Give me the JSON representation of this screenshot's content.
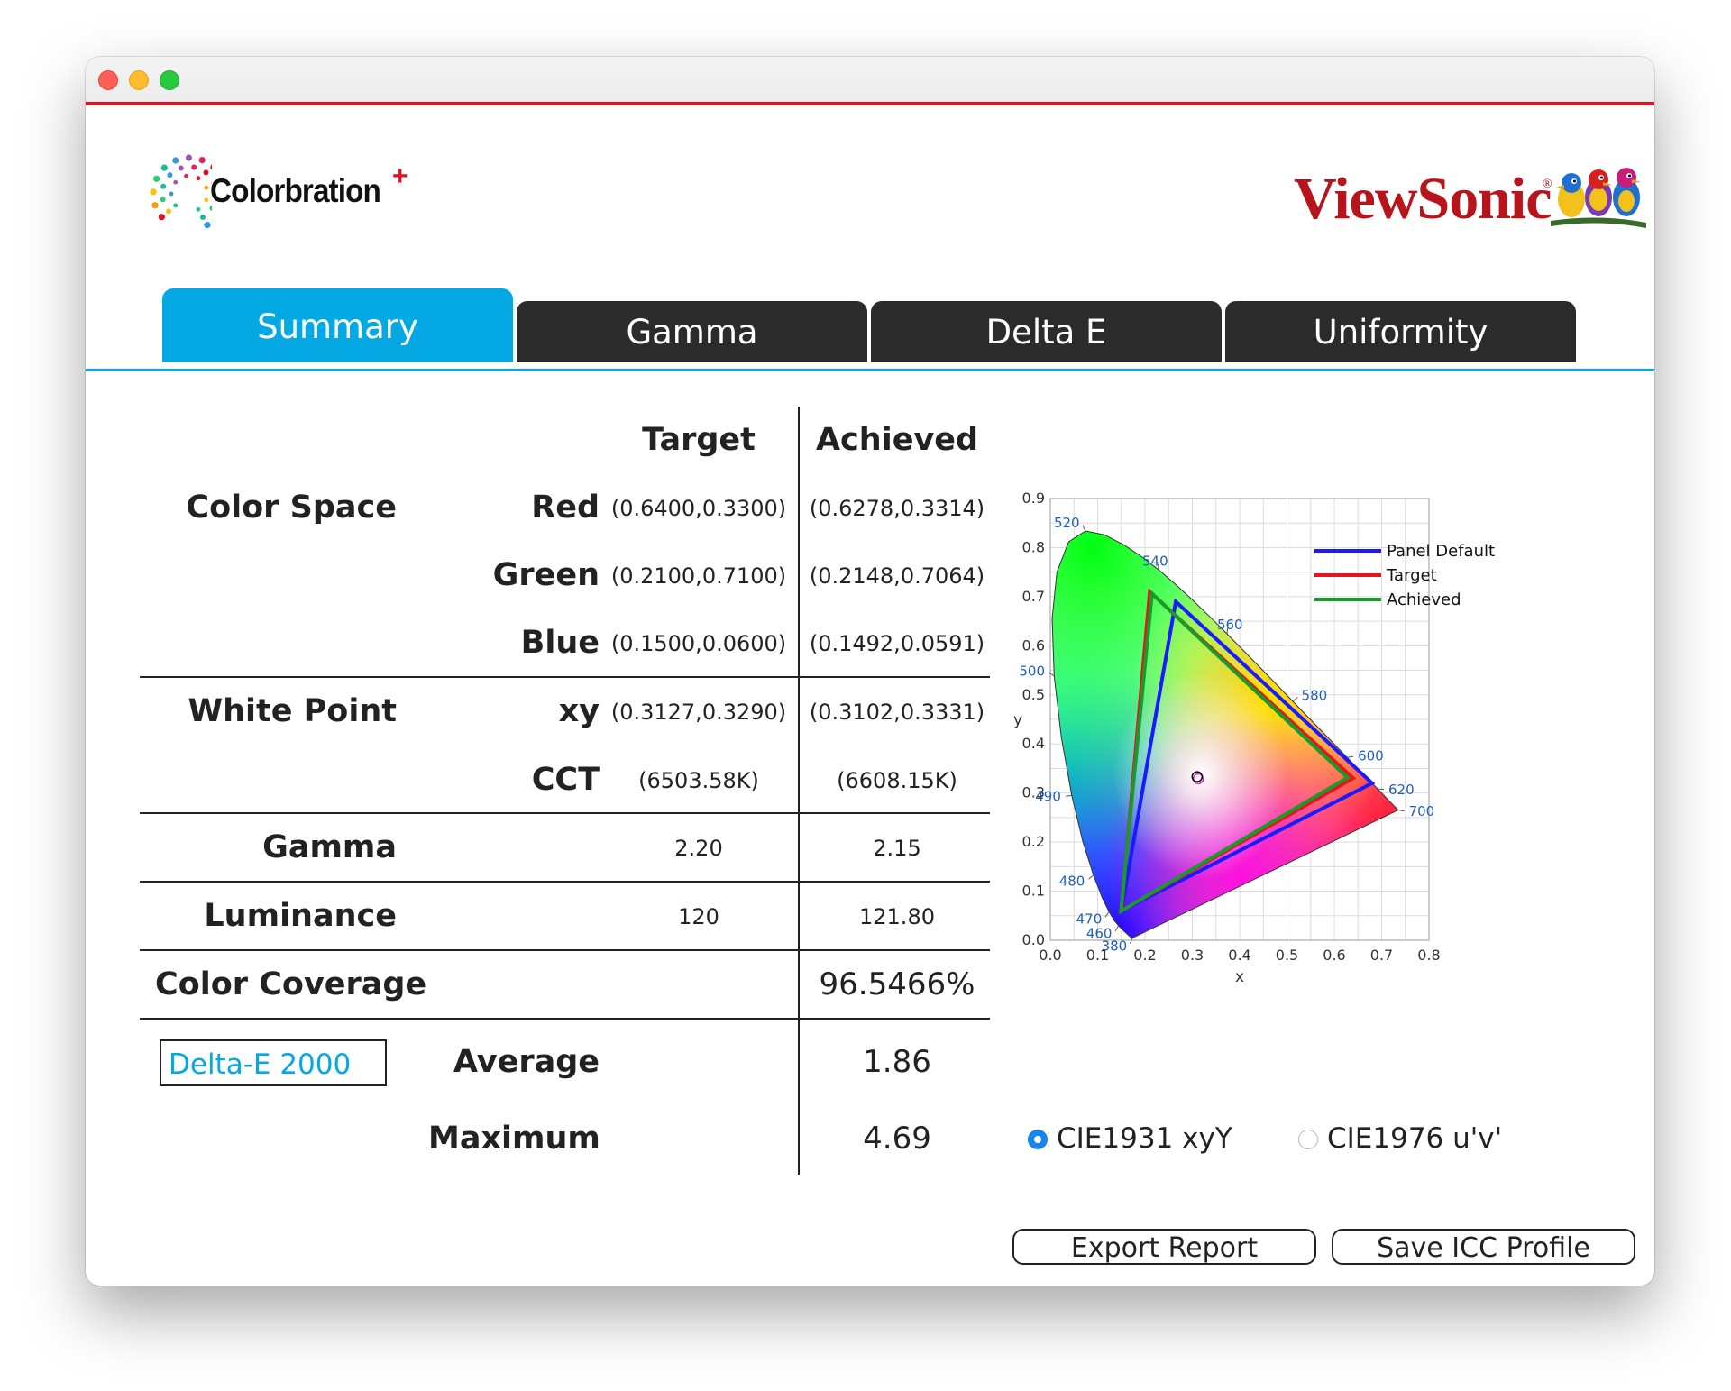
{
  "brand": {
    "left_logo": "Colorbration",
    "left_logo_mark": "+",
    "right_logo": "ViewSonic",
    "right_logo_mark": "®"
  },
  "tabs": [
    {
      "label": "Summary"
    },
    {
      "label": "Gamma"
    },
    {
      "label": "Delta E"
    },
    {
      "label": "Uniformity"
    }
  ],
  "table": {
    "header_target": "Target",
    "header_achieved": "Achieved",
    "color_space_label": "Color Space",
    "red_label": "Red",
    "green_label": "Green",
    "blue_label": "Blue",
    "red_target": "(0.6400,0.3300)",
    "red_achieved": "(0.6278,0.3314)",
    "green_target": "(0.2100,0.7100)",
    "green_achieved": "(0.2148,0.7064)",
    "blue_target": "(0.1500,0.0600)",
    "blue_achieved": "(0.1492,0.0591)",
    "white_point_label": "White Point",
    "xy_label": "xy",
    "cct_label": "CCT",
    "wp_xy_target": "(0.3127,0.3290)",
    "wp_xy_achieved": "(0.3102,0.3331)",
    "cct_target": "(6503.58K)",
    "cct_achieved": "(6608.15K)",
    "gamma_label": "Gamma",
    "gamma_target": "2.20",
    "gamma_achieved": "2.15",
    "luminance_label": "Luminance",
    "luminance_target": "120",
    "luminance_achieved": "121.80",
    "coverage_label": "Color Coverage",
    "coverage_achieved": "96.5466%",
    "delta_select": "Delta-E 2000",
    "average_label": "Average",
    "average_value": "1.86",
    "maximum_label": "Maximum",
    "maximum_value": "4.69"
  },
  "chart_data": {
    "type": "scatter",
    "xlabel": "x",
    "ylabel": "y",
    "xlim": [
      0,
      0.8
    ],
    "ylim": [
      0,
      0.9
    ],
    "xticks": [
      "0.0",
      "0.1",
      "0.2",
      "0.3",
      "0.4",
      "0.5",
      "0.6",
      "0.7",
      "0.8"
    ],
    "yticks": [
      "0.0",
      "0.1",
      "0.2",
      "0.3",
      "0.4",
      "0.5",
      "0.6",
      "0.7",
      "0.8",
      "0.9"
    ],
    "grid": true,
    "legend_position": "top-right",
    "locus": [
      [
        0.1741,
        0.005
      ],
      [
        0.1738,
        0.0049
      ],
      [
        0.1736,
        0.0049
      ],
      [
        0.1733,
        0.0048
      ],
      [
        0.173,
        0.0048
      ],
      [
        0.1726,
        0.0048
      ],
      [
        0.1721,
        0.0048
      ],
      [
        0.1714,
        0.0051
      ],
      [
        0.1703,
        0.0058
      ],
      [
        0.1689,
        0.0069
      ],
      [
        0.1669,
        0.0086
      ],
      [
        0.1644,
        0.0109
      ],
      [
        0.1611,
        0.0138
      ],
      [
        0.1566,
        0.0177
      ],
      [
        0.151,
        0.0227
      ],
      [
        0.144,
        0.0297
      ],
      [
        0.1355,
        0.0399
      ],
      [
        0.1241,
        0.0578
      ],
      [
        0.1096,
        0.0868
      ],
      [
        0.0913,
        0.1327
      ],
      [
        0.0687,
        0.2007
      ],
      [
        0.0454,
        0.295
      ],
      [
        0.0235,
        0.4127
      ],
      [
        0.0082,
        0.5384
      ],
      [
        0.0039,
        0.6548
      ],
      [
        0.0139,
        0.7502
      ],
      [
        0.0389,
        0.812
      ],
      [
        0.0743,
        0.8338
      ],
      [
        0.1142,
        0.8262
      ],
      [
        0.1547,
        0.8059
      ],
      [
        0.1929,
        0.7816
      ],
      [
        0.2296,
        0.7543
      ],
      [
        0.2658,
        0.7243
      ],
      [
        0.3016,
        0.6923
      ],
      [
        0.3373,
        0.6589
      ],
      [
        0.3731,
        0.6245
      ],
      [
        0.4087,
        0.5896
      ],
      [
        0.4441,
        0.5547
      ],
      [
        0.4788,
        0.5202
      ],
      [
        0.5125,
        0.4866
      ],
      [
        0.5448,
        0.4544
      ],
      [
        0.5752,
        0.4242
      ],
      [
        0.6029,
        0.3965
      ],
      [
        0.627,
        0.3725
      ],
      [
        0.6482,
        0.3514
      ],
      [
        0.6658,
        0.334
      ],
      [
        0.6801,
        0.3197
      ],
      [
        0.6915,
        0.3083
      ],
      [
        0.7006,
        0.2993
      ],
      [
        0.7079,
        0.292
      ],
      [
        0.714,
        0.2859
      ],
      [
        0.719,
        0.2809
      ],
      [
        0.723,
        0.277
      ],
      [
        0.726,
        0.274
      ],
      [
        0.7283,
        0.2717
      ],
      [
        0.73,
        0.27
      ],
      [
        0.7311,
        0.2689
      ],
      [
        0.732,
        0.268
      ],
      [
        0.7327,
        0.2673
      ],
      [
        0.7334,
        0.2666
      ],
      [
        0.734,
        0.266
      ],
      [
        0.7344,
        0.2656
      ],
      [
        0.7346,
        0.2654
      ],
      [
        0.7347,
        0.2653
      ]
    ],
    "wavelength_labels": [
      {
        "label": "520",
        "x": 0.0743,
        "y": 0.8338
      },
      {
        "label": "540",
        "x": 0.2296,
        "y": 0.7543
      },
      {
        "label": "560",
        "x": 0.3731,
        "y": 0.6245
      },
      {
        "label": "580",
        "x": 0.5125,
        "y": 0.4866
      },
      {
        "label": "600",
        "x": 0.627,
        "y": 0.3725
      },
      {
        "label": "620",
        "x": 0.6915,
        "y": 0.3083
      },
      {
        "label": "700",
        "x": 0.7347,
        "y": 0.2653
      },
      {
        "label": "500",
        "x": 0.0082,
        "y": 0.5384
      },
      {
        "label": "490",
        "x": 0.0454,
        "y": 0.295
      },
      {
        "label": "480",
        "x": 0.0913,
        "y": 0.1327
      },
      {
        "label": "470",
        "x": 0.1241,
        "y": 0.0578
      },
      {
        "label": "460",
        "x": 0.144,
        "y": 0.0297
      },
      {
        "label": "380",
        "x": 0.1741,
        "y": 0.005
      }
    ],
    "series": [
      {
        "name": "Panel Default",
        "color": "#1a1aff",
        "points": [
          [
            0.68,
            0.32
          ],
          [
            0.265,
            0.69
          ],
          [
            0.15,
            0.06
          ]
        ]
      },
      {
        "name": "Target",
        "color": "#e8141d",
        "points": [
          [
            0.64,
            0.33
          ],
          [
            0.21,
            0.71
          ],
          [
            0.15,
            0.06
          ]
        ]
      },
      {
        "name": "Achieved",
        "color": "#1a9a2a",
        "points": [
          [
            0.6278,
            0.3314
          ],
          [
            0.2148,
            0.7064
          ],
          [
            0.1492,
            0.0591
          ]
        ]
      }
    ],
    "white_points": [
      {
        "x": 0.3127,
        "y": 0.329,
        "color": "#e020e0"
      },
      {
        "x": 0.3102,
        "y": 0.3331,
        "color": "#000000"
      }
    ]
  },
  "radios": {
    "cie1931": "CIE1931 xyY",
    "cie1976": "CIE1976 u'v'"
  },
  "buttons": {
    "export": "Export Report",
    "save_icc": "Save ICC Profile"
  },
  "colors": {
    "accent": "#04a9e3",
    "brand_red": "#e3101d",
    "tab_dark": "#2b2b2b"
  }
}
